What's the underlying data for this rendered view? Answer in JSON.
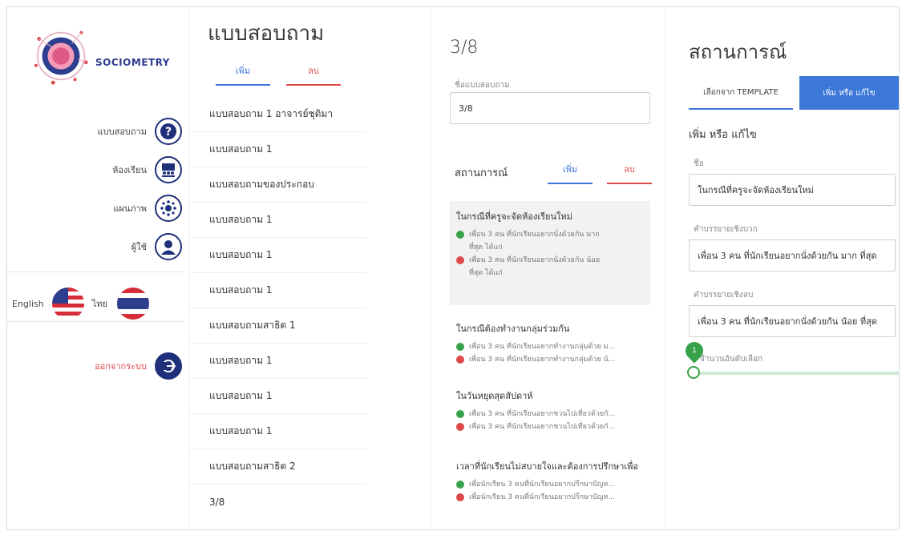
{
  "sidebar": {
    "brand": "SOCIOMETRY",
    "nav": [
      {
        "label": "แบบสอบถาม",
        "icon": "question-icon"
      },
      {
        "label": "ห้องเรียน",
        "icon": "classroom-icon"
      },
      {
        "label": "แผนภาพ",
        "icon": "network-icon"
      },
      {
        "label": "ผู้ใช้",
        "icon": "user-icon"
      }
    ],
    "lang_en": "English",
    "lang_th": "ไทย",
    "logout": "ออกจากระบบ"
  },
  "questionnaires": {
    "title": "แบบสอบถาม",
    "add": "เพิ่ม",
    "delete": "ลบ",
    "items": [
      "แบบสอบถาม 1 อาจารย์ชุติมา",
      "แบบสอบถาม 1",
      "แบบสอบถามของประกอบ",
      "แบบสอบถาม 1",
      "แบบสอบถาม 1",
      "แบบสอบถาม 1",
      "แบบสอบถามสาธิต 1",
      "แบบสอบถาม 1",
      "แบบสอบถาม 1",
      "แบบสอบถาม 1",
      "แบบสอบถามสาธิต 2",
      "3/8"
    ]
  },
  "detail": {
    "title": "3/8",
    "name_label": "ชื่อแบบสอบถาม",
    "name_value": "3/8",
    "scenarios_title": "สถานการณ์",
    "add": "เพิ่ม",
    "delete": "ลบ",
    "scenarios": [
      {
        "title": "ในกรณีที่ครูจะจัดห้องเรียนใหม่",
        "pos": "เพื่อน 3 คน ที่นักเรียนอยากนั่งด้วยกัน มาก",
        "pos2": "ที่สุด ได้แก่",
        "neg": "เพื่อน 3 คน ที่นักเรียนอยากนั่งด้วยกัน น้อย",
        "neg2": "ที่สุด ได้แก่"
      },
      {
        "title": "ในกรณีต้องทำงานกลุ่มร่วมกัน",
        "pos": "เพื่อน 3 คน ที่นักเรียนอยากทำงานกลุ่มด้วย ม...",
        "neg": "เพื่อน 3 คน ที่นักเรียนอยากทำงานกลุ่มด้วย น้..."
      },
      {
        "title": "ในวันหยุดสุดสัปดาห์",
        "pos": "เพื่อน 3 คน ที่นักเรียนอยากชวนไปเที่ยวด้วยกั...",
        "neg": "เพื่อน 3 คน ที่นักเรียนอยากชวนไปเที่ยวด้วยกั..."
      },
      {
        "title": "เวลาที่นักเรียนไม่สบายใจและต้องการปรึกษาเพื่อ",
        "pos": "เพื่อนักเรียน 3 คนที่นักเรียนอยากปรึกษาปัญห...",
        "neg": "เพื่อนักเรียน 3 คนที่นักเรียนอยากปรึกษาปัญห..."
      }
    ]
  },
  "editor": {
    "title": "สถานการณ์",
    "tab_template": "เลือกจาก TEMPLATE",
    "tab_edit": "เพิ่ม หรือ แก้ไข",
    "subtitle": "เพิ่ม หรือ แก้ไข",
    "name_label": "ชื่อ",
    "name_value": "ในกรณีที่ครูจะจัดห้องเรียนใหม่",
    "pos_label": "คำบรรยายเชิงบวก",
    "pos_value": "เพื่อน 3 คน ที่นักเรียนอยากนั่งด้วยกัน มาก ที่สุด",
    "neg_label": "คำบรรยายเชิงลบ",
    "neg_value": "เพื่อน 3 คน ที่นักเรียนอยากนั่งด้วยกัน น้อย ที่สุด",
    "slider_label": "จำนวนอันดับเลือก",
    "slider_value": "1"
  },
  "colors": {
    "blue": "#3b78d8",
    "red": "#e04848",
    "navy": "#1f2f7a",
    "green": "#37a24a"
  }
}
